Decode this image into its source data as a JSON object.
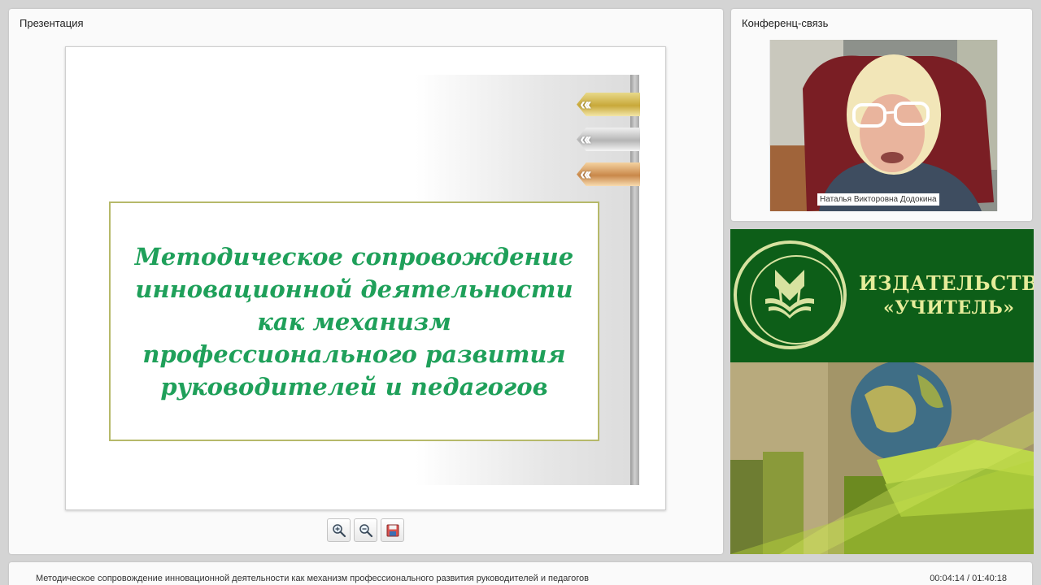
{
  "presentation": {
    "title": "Презентация",
    "slide": {
      "title": "Методическое сопровождение инновационной деятельности как механизм профессионального развития руководителей и педагогов"
    }
  },
  "toolbar": {
    "zoom_in_icon": "zoom-in-icon",
    "zoom_out_icon": "zoom-out-icon",
    "save_icon": "floppy-disk-icon"
  },
  "conference": {
    "title": "Конференц-связь",
    "speaker_name": "Наталья Викторовна Додокина"
  },
  "banner": {
    "brand_line1": "ИЗДАТЕЛЬСТВО",
    "brand_line2": "«УЧИТЕЛЬ»"
  },
  "footer": {
    "title": "Методическое сопровождение инновационной деятельности как механизм профессионального развития руководителей и педагогов",
    "time": "00:04:14 / 01:40:18"
  },
  "colors": {
    "slide_title": "#1fa05a",
    "banner_green": "#0d5e18",
    "brand_text": "#e6ec9a"
  }
}
